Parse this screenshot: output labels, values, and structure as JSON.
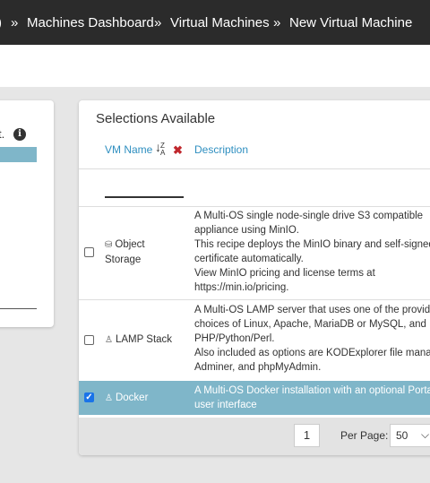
{
  "breadcrumb": {
    "home_fragment": ")",
    "items": [
      "Machines Dashboard",
      "Virtual Machines",
      "New Virtual Machine"
    ],
    "separator": "»"
  },
  "left_panel": {
    "text_fragment": "t.",
    "info_icon": "info-icon"
  },
  "selections": {
    "title": "Selections Available",
    "headers": {
      "name": "VM Name",
      "description": "Description"
    },
    "filter": {
      "value": "",
      "placeholder": ""
    },
    "rows": [
      {
        "checked": false,
        "icon": "storage-icon",
        "name_line1": "Object",
        "name_line2": "Storage",
        "description": [
          "A Multi-OS single node-single drive S3 compatible",
          "appliance using MinIO.",
          "This recipe deploys the MinIO binary and self-signed",
          "certificate automatically.",
          "View MinIO pricing and license terms at",
          "https://min.io/pricing."
        ]
      },
      {
        "checked": false,
        "icon": "linux-icon",
        "name": "LAMP Stack",
        "description": [
          "A Multi-OS LAMP server that uses one of the provid",
          "choices of Linux, Apache, MariaDB or MySQL, and",
          "PHP/Python/Perl.",
          "Also included as options are KODExplorer file manag",
          "Adminer, and phpMyAdmin."
        ]
      },
      {
        "checked": true,
        "icon": "linux-icon",
        "name": "Docker",
        "description": [
          "A Multi-OS Docker installation with an optional Porta",
          "user interface"
        ]
      }
    ],
    "pagination": {
      "page": "1",
      "per_page_label": "Per Page:",
      "per_page": "50"
    }
  },
  "colors": {
    "topbar": "#2b2b2b",
    "selected_row": "#7fb6c9",
    "link": "#2f8fc0",
    "clear_filter": "#c0272d"
  }
}
